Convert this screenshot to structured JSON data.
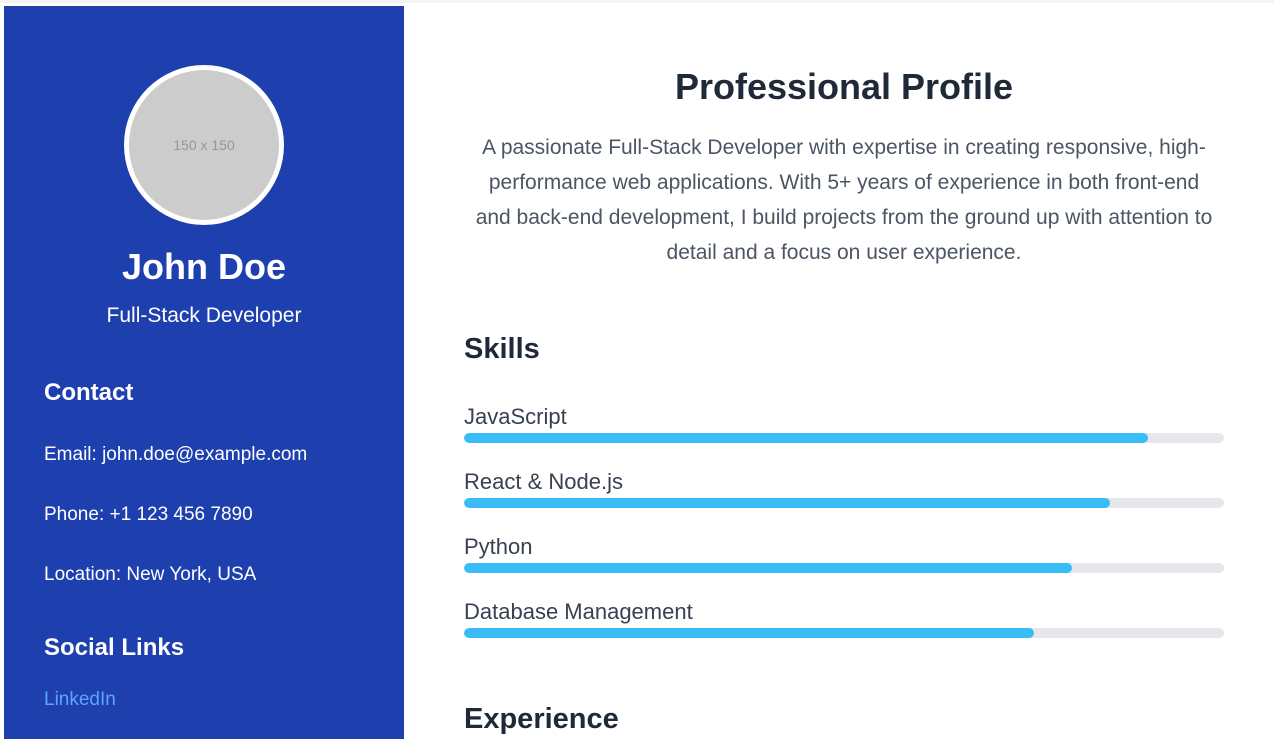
{
  "sidebar": {
    "avatar_placeholder": "150 x 150",
    "name": "John Doe",
    "role": "Full-Stack Developer",
    "contact_heading": "Contact",
    "email": "Email: john.doe@example.com",
    "phone": "Phone: +1 123 456 7890",
    "location": "Location: New York, USA",
    "social_heading": "Social Links",
    "social_links": [
      "LinkedIn"
    ]
  },
  "main": {
    "profile_title": "Professional Profile",
    "profile_text": "A passionate Full-Stack Developer with expertise in creating responsive, high-performance web applications. With 5+ years of experience in both front-end and back-end development, I build projects from the ground up with attention to detail and a focus on user experience.",
    "skills_title": "Skills",
    "skills": [
      {
        "label": "JavaScript",
        "level": 90
      },
      {
        "label": "React & Node.js",
        "level": 85
      },
      {
        "label": "Python",
        "level": 80
      },
      {
        "label": "Database Management",
        "level": 75
      }
    ],
    "experience_title": "Experience"
  },
  "colors": {
    "sidebar_bg": "#1e40af",
    "accent": "#38bdf8",
    "link": "#60a5fa",
    "track": "#e5e7eb"
  }
}
